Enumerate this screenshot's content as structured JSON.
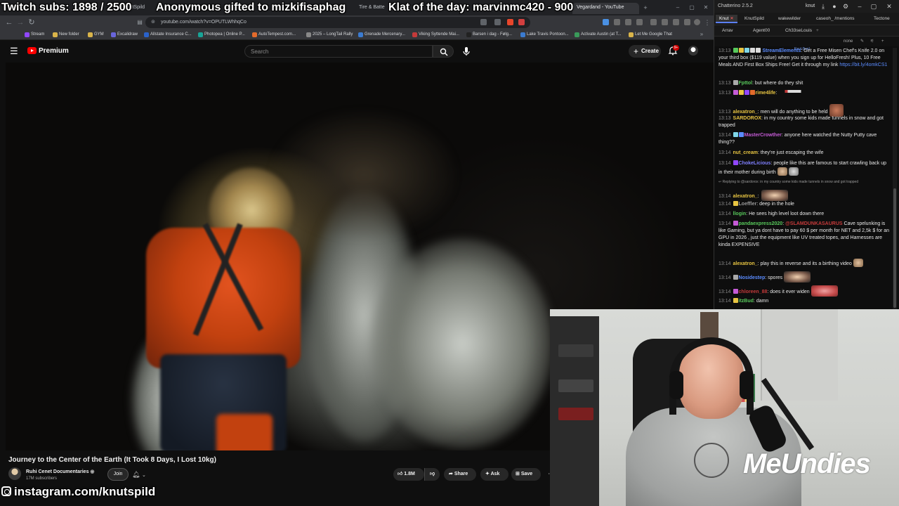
{
  "ticker": {
    "subs": "Twitch subs: 1898 / 2500",
    "gift": "Anonymous gifted to mizkifisaphag",
    "klat": "Klat of the day: marvinmc420 - 900"
  },
  "browser": {
    "tabs": [
      {
        "label": "KnutSpild"
      },
      {
        "label": "Tire & Batte"
      },
      {
        "label": "Vegardand - YouTube"
      }
    ],
    "url": "youtube.com/watch?v=OPUTLWhhqCo",
    "bookmarks": [
      {
        "label": "Stream",
        "color": "#9147ff"
      },
      {
        "label": "New folder",
        "color": "#d9b44a"
      },
      {
        "label": "GYM",
        "color": "#d9b44a"
      },
      {
        "label": "Excalidraw",
        "color": "#6965db"
      },
      {
        "label": "Allstate Insurance C...",
        "color": "#2a62c9"
      },
      {
        "label": "Photopea | Online P...",
        "color": "#18a497"
      },
      {
        "label": "AutoTempest.com...",
        "color": "#e36b2c"
      },
      {
        "label": "2025 – LongTail Rally",
        "color": "#888888"
      },
      {
        "label": "Grenade Mercenary...",
        "color": "#3b7bd0"
      },
      {
        "label": "Viking Syttende Mai...",
        "color": "#c43a3a"
      },
      {
        "label": "Barsen i dag - Følg...",
        "color": "#222222"
      },
      {
        "label": "Lake Travis Pontoon...",
        "color": "#3b7bd0"
      },
      {
        "label": "Activate Austin (at T...",
        "color": "#3a9a5a"
      },
      {
        "label": "Let Me Google That",
        "color": "#d9b44a"
      }
    ]
  },
  "youtube": {
    "logo_text": "Premium",
    "search_placeholder": "Search",
    "create_label": "Create",
    "notif_count": "9+",
    "video_title": "Journey to the Center of the Earth (It Took 8 Days, I Lost 10kg)",
    "channel_name": "Ruhi Cenet Documentaries",
    "channel_subs": "17M subscribers",
    "join_label": "Join",
    "like_count": "1.8M",
    "share_label": "Share",
    "ask_label": "Ask",
    "save_label": "Save"
  },
  "overlay": {
    "instagram": "instagram.com/knutspild",
    "sponsor": "MeUndies"
  },
  "chat": {
    "app_title": "Chatterino 2.5.2",
    "channel": "knut",
    "tabs_row1": [
      "Knut",
      "KnutSpild",
      "wakewilder",
      "caseoh_ /mentions",
      "Tectone"
    ],
    "tabs_row2": [
      "Arrav",
      "Agent00",
      "Ch33seLouis"
    ],
    "mode_label": "none",
    "live_label": "Knut (live)",
    "reply_to": "Replying to @sardorox: in my country some kids made tunnels in snow and got trapped",
    "messages": [
      {
        "time": "13:13",
        "user": "StreamElements",
        "color": "#5b8cff",
        "text": "Get a Free Misen Chef's Knife 2.0 on your third box ($119 value) when you sign up for HelloFresh! Plus, 10 Free Meals AND First Box Ships Free! Get it through my link https://bit.ly/4omkCS1",
        "link": "https://bit.ly/4omkCS1"
      },
      {
        "time": "13:13",
        "user": "Fpttol",
        "color": "#58c95b",
        "text": "but where do they shit"
      },
      {
        "time": "13:13",
        "user": "rime4life",
        "color": "#e8c542",
        "text": ""
      },
      {
        "time": "13:13",
        "user": "alexatron_",
        "color": "#e8c542",
        "text": "men will do anything to be held"
      },
      {
        "time": "13:13",
        "user": "SARDOROX",
        "color": "#e8c542",
        "text": "in my country some kids made tunnels in snow and got trapped"
      },
      {
        "time": "13:14",
        "user": "MasterCrowther",
        "color": "#c55bd6",
        "text": "anyone here watched the Nutty Putty cave thing??"
      },
      {
        "time": "13:14",
        "user": "nut_cream",
        "color": "#e8c542",
        "text": "they're just escaping the wife"
      },
      {
        "time": "13:14",
        "user": "ChokeLicious",
        "color": "#7f7fff",
        "text": "people like this are famous to start crawling back up in their mother during birth"
      },
      {
        "time": "13:14",
        "user": "alexatron_",
        "color": "#e8c542",
        "text": ""
      },
      {
        "time": "13:14",
        "user": "Loeffler",
        "color": "#9a9a9a",
        "text": "deep in the hole"
      },
      {
        "time": "13:14",
        "user": "llogin",
        "color": "#58c95b",
        "text": "He sees high level loot down there"
      },
      {
        "time": "13:14",
        "user": "pandaexpress2020",
        "color": "#58c95b",
        "mention": "@SLAMDUNKASAURUS",
        "text": "Cave spelunking is like Gaming, but ya dont have to pay 60 $ per month for NET and 2,5k $ for an GPU in 2026 , just the equipment like UV treated topes, and Harnesses are kinda EXPENSIVE"
      },
      {
        "time": "13:14",
        "user": "alexatron_",
        "color": "#e8c542",
        "text": "play this in reverse and its a birthing video"
      },
      {
        "time": "13:14",
        "user": "Nosidestep",
        "color": "#5b8cff",
        "text": "spores"
      },
      {
        "time": "13:14",
        "user": "chloreen_88",
        "color": "#c43a3a",
        "text": "does it ever widen"
      },
      {
        "time": "13:14",
        "user": "itzBud",
        "color": "#58c95b",
        "text": "damn"
      }
    ]
  },
  "colors": {
    "accent": "#ff0000",
    "chat_bg": "#0e0e0e",
    "mention": "#c43a3a",
    "link": "#5b8cff"
  }
}
